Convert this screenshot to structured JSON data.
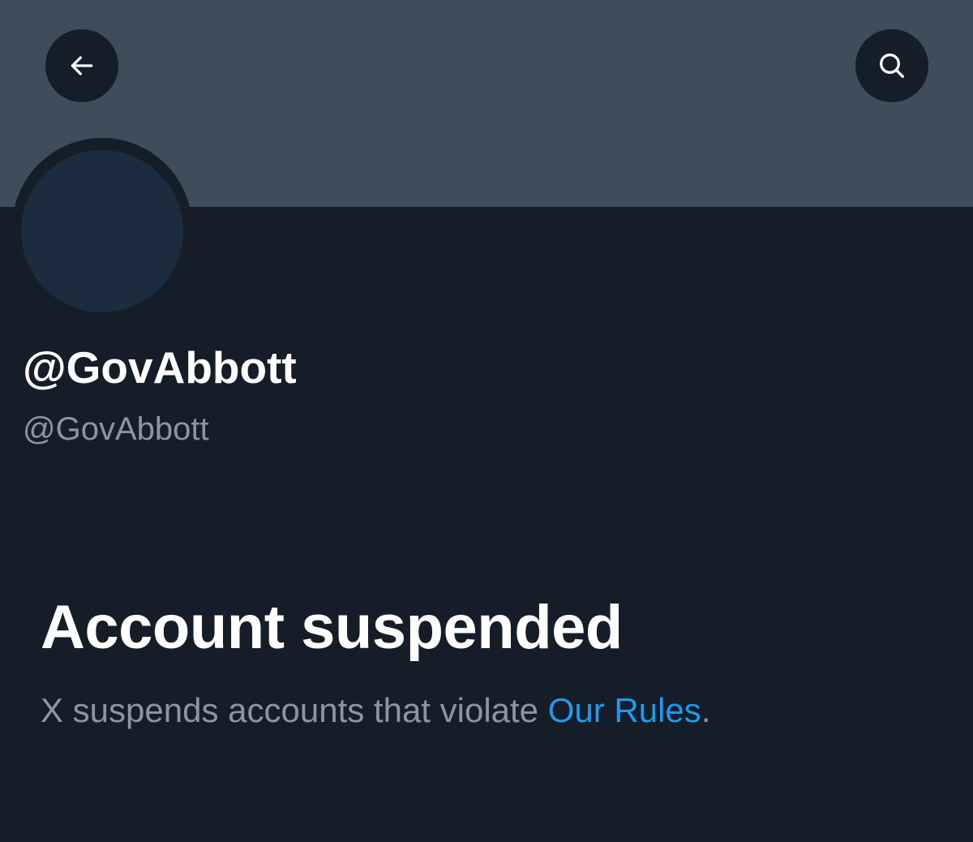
{
  "header": {
    "back_icon": "arrow-left-icon",
    "search_icon": "search-icon"
  },
  "profile": {
    "display_name": "@GovAbbott",
    "handle": "@GovAbbott"
  },
  "suspension": {
    "title": "Account suspended",
    "message_prefix": "X suspends accounts that violate ",
    "link_text": "Our Rules",
    "message_suffix": "."
  },
  "colors": {
    "background": "#151d29",
    "banner": "#3e4c5c",
    "avatar": "#1c2b3e",
    "primary_text": "#ffffff",
    "secondary_text": "#8a96a3",
    "link": "#1d9bf0"
  }
}
